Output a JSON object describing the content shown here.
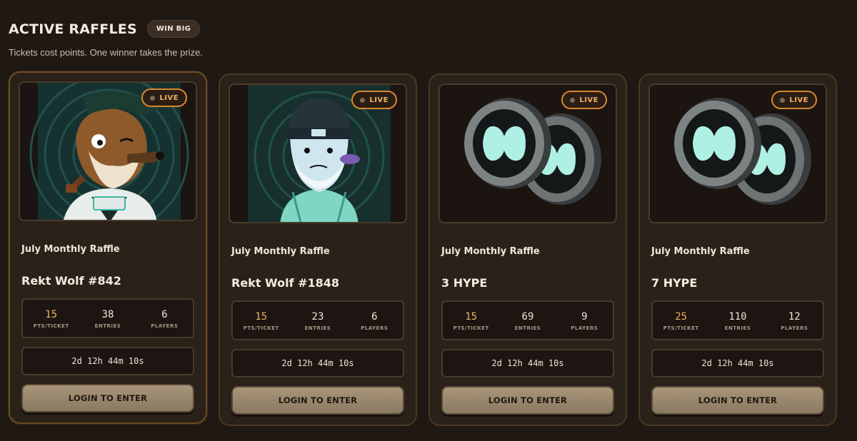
{
  "header": {
    "title": "ACTIVE RAFFLES",
    "badge": "WIN BIG",
    "subtitle": "Tickets cost points. One winner takes the prize."
  },
  "colors": {
    "background": "#1f1813",
    "card": "#2a2119",
    "live_border": "#d8862e",
    "accent_value": "#f2b25c",
    "button": "#a89579"
  },
  "cards": [
    {
      "live": "LIVE",
      "raffle_name": "July Monthly Raffle",
      "prize": "Rekt Wolf #842",
      "image": "rekt-wolf-with-pipe-image",
      "stats": [
        {
          "value": "15",
          "label": "PTS/TICKET"
        },
        {
          "value": "38",
          "label": "ENTRIES"
        },
        {
          "value": "6",
          "label": "PLAYERS"
        }
      ],
      "timer": "2d 12h 44m 10s",
      "button": "LOGIN TO ENTER"
    },
    {
      "live": "LIVE",
      "raffle_name": "July Monthly Raffle",
      "prize": "Rekt Wolf #1848",
      "image": "rekt-wolf-with-beanie-image",
      "stats": [
        {
          "value": "15",
          "label": "PTS/TICKET"
        },
        {
          "value": "23",
          "label": "ENTRIES"
        },
        {
          "value": "6",
          "label": "PLAYERS"
        }
      ],
      "timer": "2d 12h 44m 10s",
      "button": "LOGIN TO ENTER"
    },
    {
      "live": "LIVE",
      "raffle_name": "July Monthly Raffle",
      "prize": "3 HYPE",
      "image": "hype-coins-image",
      "stats": [
        {
          "value": "15",
          "label": "PTS/TICKET"
        },
        {
          "value": "69",
          "label": "ENTRIES"
        },
        {
          "value": "9",
          "label": "PLAYERS"
        }
      ],
      "timer": "2d 12h 44m 10s",
      "button": "LOGIN TO ENTER"
    },
    {
      "live": "LIVE",
      "raffle_name": "July Monthly Raffle",
      "prize": "7 HYPE",
      "image": "hype-coins-image",
      "stats": [
        {
          "value": "25",
          "label": "PTS/TICKET"
        },
        {
          "value": "110",
          "label": "ENTRIES"
        },
        {
          "value": "12",
          "label": "PLAYERS"
        }
      ],
      "timer": "2d 12h 44m 10s",
      "button": "LOGIN TO ENTER"
    }
  ]
}
